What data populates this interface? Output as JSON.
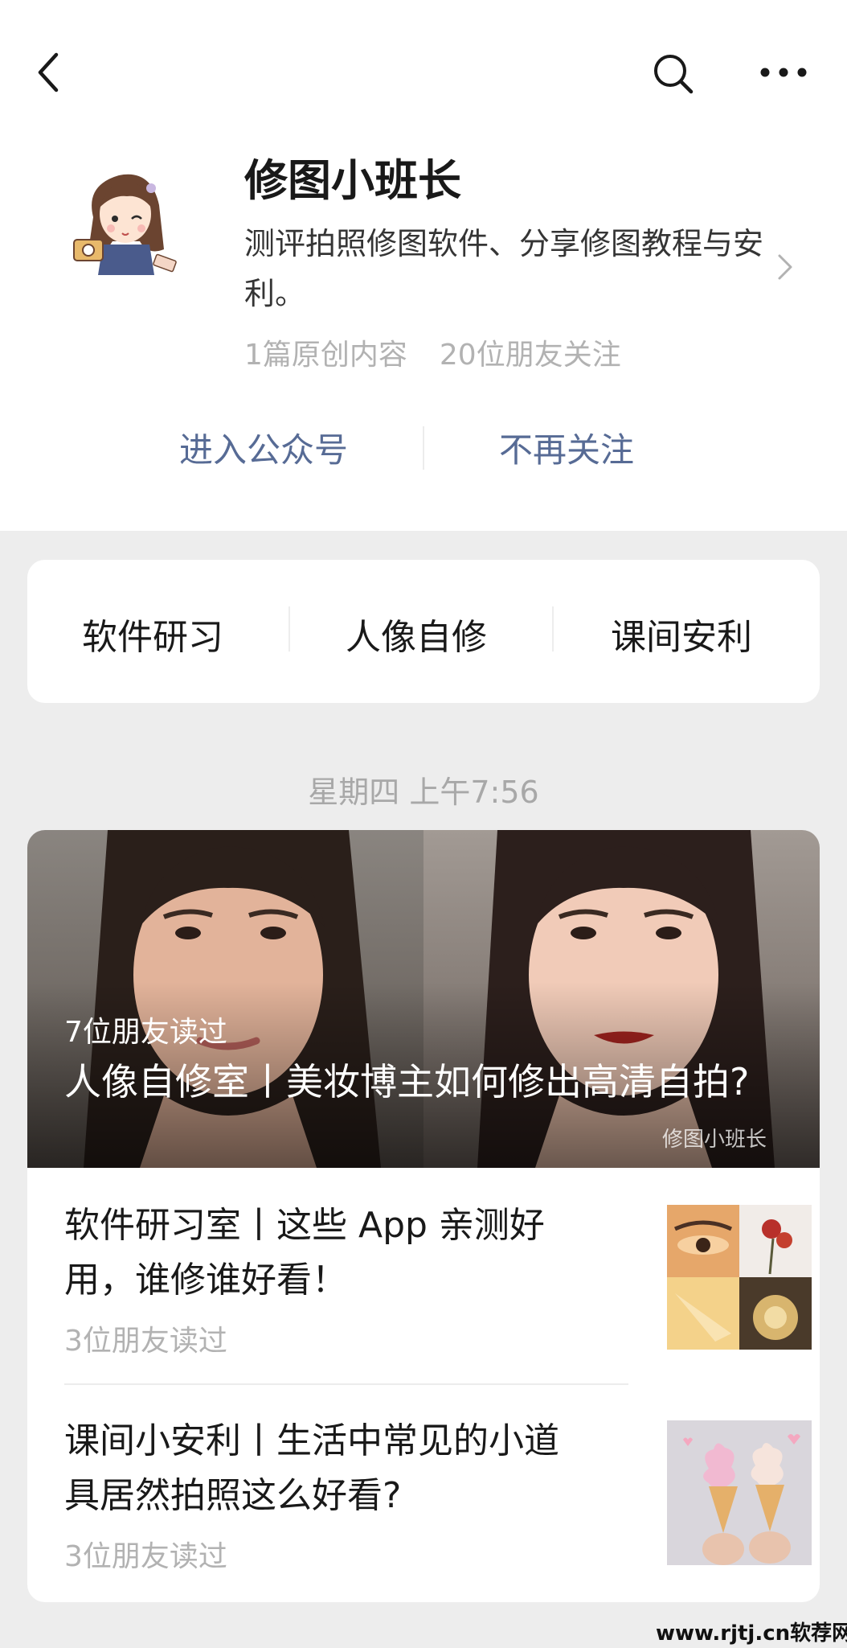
{
  "nav": {
    "back_icon": "chevron-left-icon",
    "search_icon": "search-icon",
    "more_icon": "more-icon"
  },
  "account": {
    "name": "修图小班长",
    "description": "测评拍照修图软件、分享修图教程与安利。",
    "original_count": "1篇原创内容",
    "friends_following": "20位朋友关注"
  },
  "actions": {
    "enter": "进入公众号",
    "unfollow": "不再关注"
  },
  "menu": {
    "items": [
      {
        "label": "软件研习"
      },
      {
        "label": "人像自修"
      },
      {
        "label": "课间安利"
      }
    ]
  },
  "feed": {
    "timestamp": "星期四 上午7:56",
    "cover": {
      "reads": "7位朋友读过",
      "title": "人像自修室丨美妆博主如何修出高清自拍?",
      "watermark": "修图小班长"
    },
    "articles": [
      {
        "title": "软件研习室丨这些 App 亲测好用，谁修谁好看！",
        "reads": "3位朋友读过"
      },
      {
        "title": "课间小安利丨生活中常见的小道具居然拍照这么好看?",
        "reads": "3位朋友读过"
      }
    ]
  },
  "watermark": "www.rjtj.cn软荐网",
  "colors": {
    "link": "#576b95",
    "muted": "#b2b2b2",
    "background": "#ededed",
    "card": "#ffffff"
  }
}
